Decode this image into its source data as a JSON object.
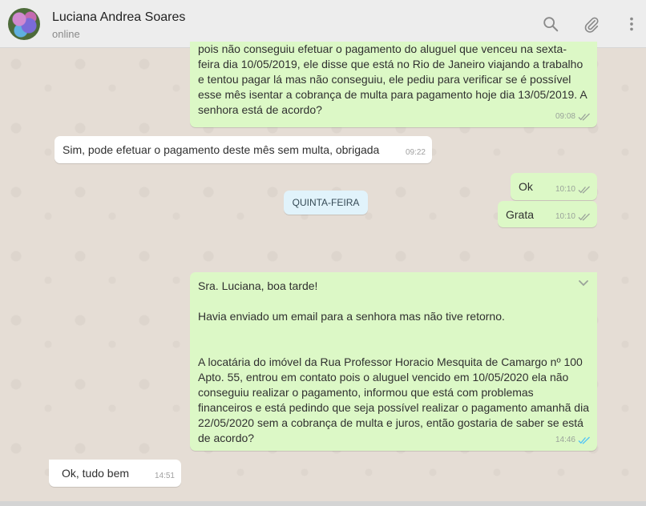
{
  "header": {
    "contact_name": "Luciana Andrea Soares",
    "status": "online",
    "icons": [
      "search-icon",
      "attach-icon",
      "menu-icon"
    ]
  },
  "messages": [
    {
      "direction": "out",
      "text": "pois não conseguiu efetuar o pagamento do aluguel que venceu na sexta-\nfeira dia 10/05/2019, ele disse que está no Rio de Janeiro viajando a trabalho\ne tentou pagar lá mas não conseguiu, ele pediu para verificar se é possível\nesse mês isentar a cobrança de multa para pagamento hoje dia 13/05/2019. A\nsenhora está de acordo?",
      "time": "09:08",
      "status": "delivered"
    },
    {
      "direction": "in",
      "text": "Sim, pode efetuar o pagamento deste mês sem multa, obrigada",
      "time": "09:22"
    },
    {
      "direction": "out",
      "text": "Ok",
      "time": "10:10",
      "status": "delivered"
    },
    {
      "direction": "out",
      "text": "Grata",
      "time": "10:10",
      "status": "delivered"
    },
    {
      "direction": "out",
      "text": "Sra. Luciana, boa tarde!\n\nHavia enviado um email para a senhora mas não tive retorno.\n\n\nA locatária do imóvel da Rua Professor Horacio Mesquita de Camargo nº 100\nApto. 55, entrou em contato pois o aluguel vencido em 10/05/2020 ela não\nconseguiu realizar o pagamento, informou que está com problemas\nfinanceiros e está pedindo que seja possível realizar o pagamento amanhã dia\n22/05/2020 sem a cobrança de multa e juros, então gostaria de saber se está\nde acordo?",
      "time": "14:46",
      "status": "read"
    },
    {
      "direction": "in",
      "text": "Ok, tudo bem",
      "time": "14:51"
    }
  ],
  "day_separator": "QUINTA-FEIRA",
  "colors": {
    "outgoing_bubble": "#dcf8c6",
    "incoming_bubble": "#ffffff",
    "read_ticks": "#4fc3f7",
    "delivered_ticks": "#9aa39a",
    "chat_background": "#e5ddd5"
  }
}
